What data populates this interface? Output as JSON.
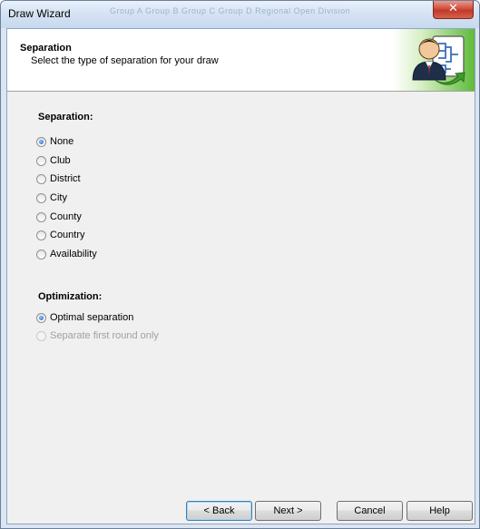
{
  "window": {
    "title": "Draw Wizard",
    "title_ghost_text": "Group A   Group B   Group C   Group D   Regional Open Division",
    "close_symbol": "✕"
  },
  "header": {
    "title": "Separation",
    "subtitle": "Select the type of separation for your draw",
    "icon": "person-with-bracket-icon"
  },
  "separation": {
    "heading": "Separation:",
    "options": [
      {
        "label": "None",
        "checked": true
      },
      {
        "label": "Club",
        "checked": false
      },
      {
        "label": "District",
        "checked": false
      },
      {
        "label": "City",
        "checked": false
      },
      {
        "label": "County",
        "checked": false
      },
      {
        "label": "Country",
        "checked": false
      },
      {
        "label": "Availability",
        "checked": false
      }
    ]
  },
  "optimization": {
    "heading": "Optimization:",
    "options": [
      {
        "label": "Optimal separation",
        "checked": true,
        "enabled": true
      },
      {
        "label": "Separate first round only",
        "checked": false,
        "enabled": false
      }
    ]
  },
  "buttons": {
    "back": "< Back",
    "next": "Next >",
    "cancel": "Cancel",
    "help": "Help"
  },
  "colors": {
    "accent_green": "#5fbb3a",
    "radio_selected": "#1d5fb8",
    "close_red": "#c0392b"
  }
}
